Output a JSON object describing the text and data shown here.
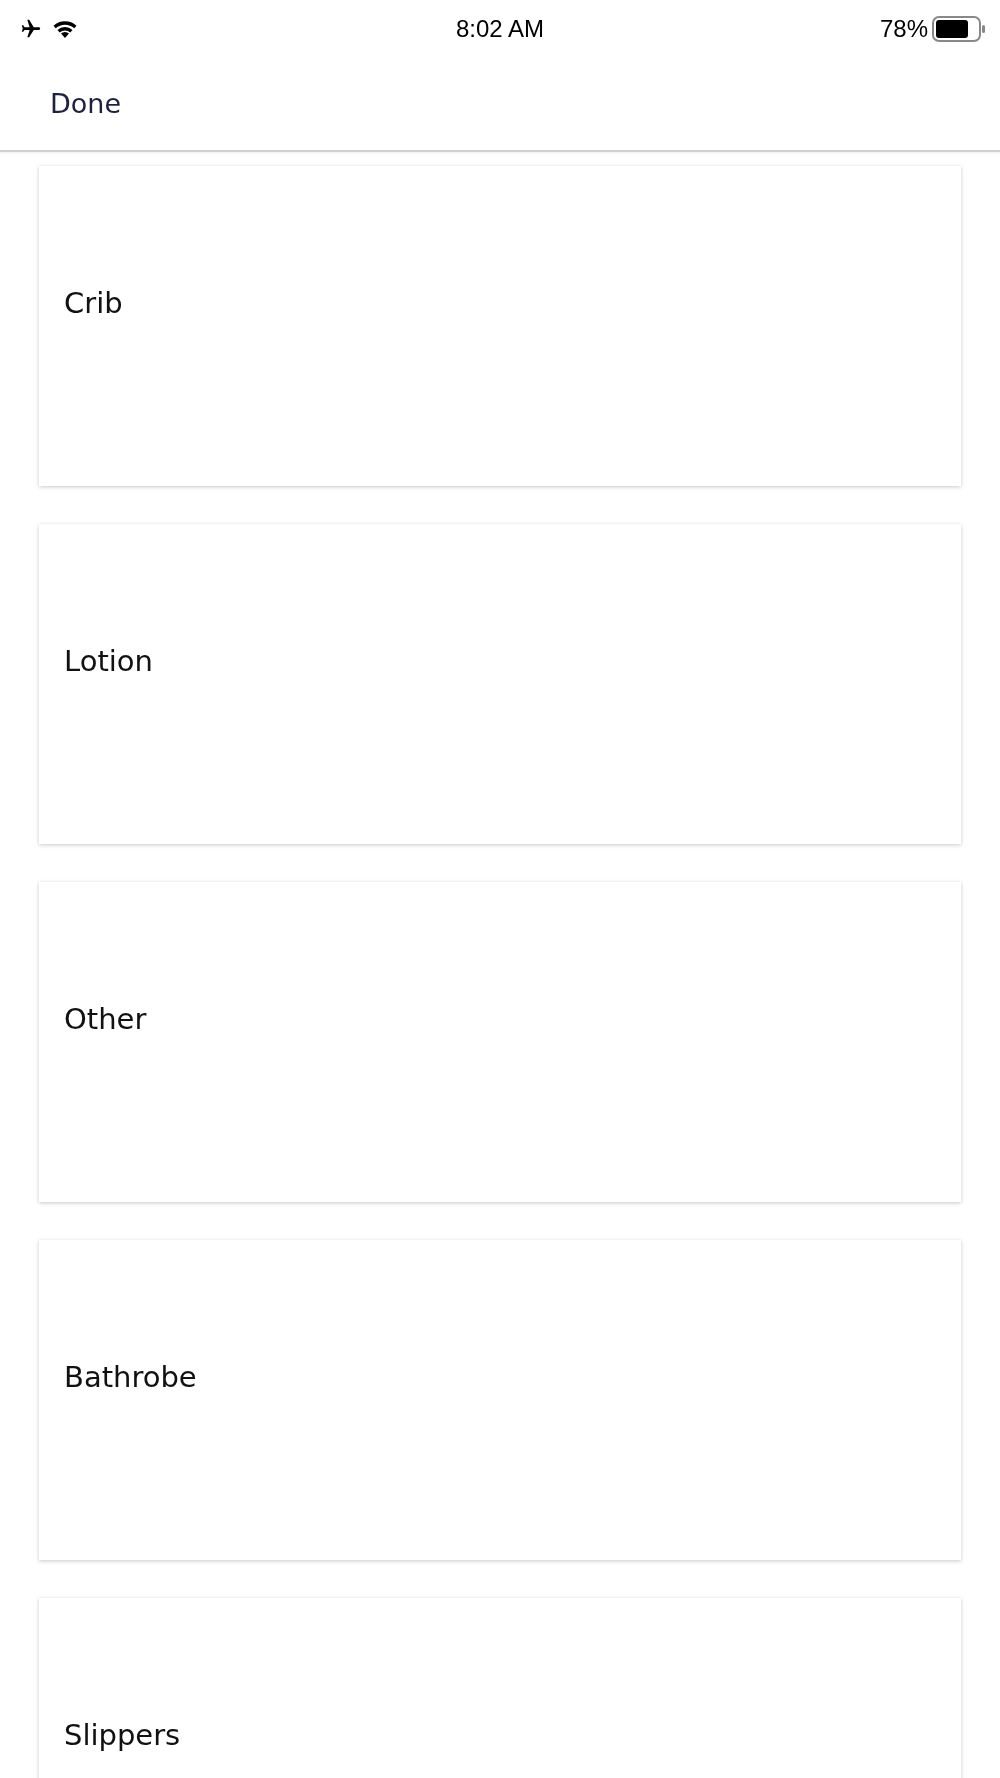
{
  "status_bar": {
    "time": "8:02 AM",
    "battery": "78%"
  },
  "header": {
    "done": "Done"
  },
  "items": [
    {
      "label": "Crib"
    },
    {
      "label": "Lotion"
    },
    {
      "label": "Other"
    },
    {
      "label": "Bathrobe"
    },
    {
      "label": "Slippers"
    }
  ]
}
